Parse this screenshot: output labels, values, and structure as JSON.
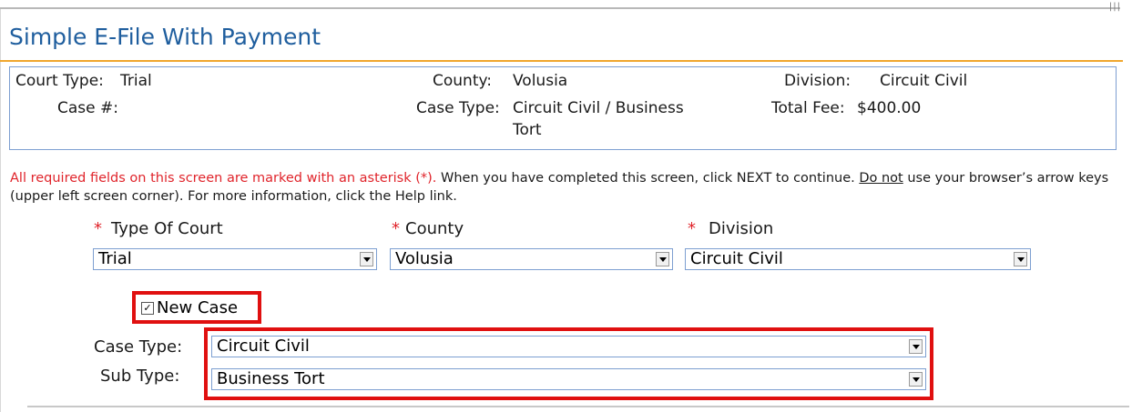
{
  "page": {
    "title": "Simple E-File With Payment",
    "corner_glyph": "|||"
  },
  "summary": {
    "court_type_label": "Court Type:",
    "court_type_value": "Trial",
    "case_no_label": "Case #:",
    "case_no_value": "",
    "county_label": "County:",
    "county_value": "Volusia",
    "case_type_label": "Case Type:",
    "case_type_value_line1": "Circuit Civil / Business",
    "case_type_value_line2": "Tort",
    "division_label": "Division:",
    "division_value": "Circuit Civil",
    "total_fee_label": "Total Fee:",
    "total_fee_value": "$400.00"
  },
  "instructions": {
    "required_text": "All required fields on this screen are marked with an asterisk (*).",
    "continue_text": " When you have completed this screen, click NEXT to continue. ",
    "do_not_text": "Do not",
    "tail_text": " use your browser’s arrow keys (upper left screen corner). For more information, click the Help link."
  },
  "form": {
    "asterisk": "*",
    "type_of_court_label": "Type Of Court",
    "type_of_court_value": "Trial",
    "county_label": "County",
    "county_value": "Volusia",
    "division_label": "Division",
    "division_value": "Circuit Civil",
    "new_case_label": "New Case",
    "new_case_checked": true,
    "check_glyph": "✓",
    "case_type_label": "Case Type:",
    "case_type_value": "Circuit Civil",
    "sub_type_label": "Sub Type:",
    "sub_type_value": "Business Tort"
  },
  "colors": {
    "title_blue": "#1f5e9e",
    "accent_orange": "#f0a72e",
    "required_red": "#e0242b",
    "highlight_red": "#e01010",
    "border_blue": "#7d9fd1"
  }
}
